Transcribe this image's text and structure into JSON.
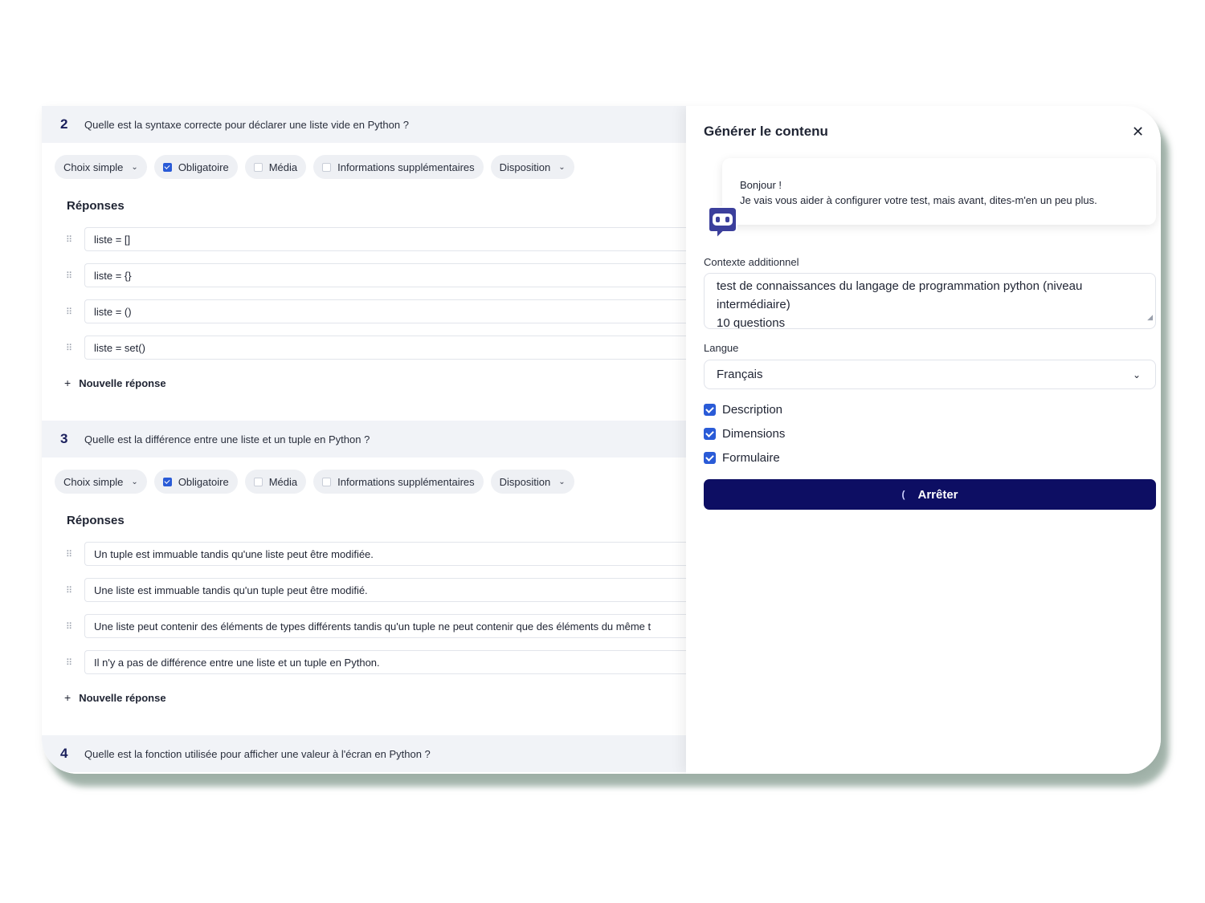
{
  "questions": [
    {
      "number": "2",
      "title": "Quelle est la syntaxe correcte pour déclarer une liste vide en Python ?",
      "type_label": "Choix simple",
      "required_label": "Obligatoire",
      "required_checked": true,
      "media_label": "Média",
      "media_checked": false,
      "extra_info_label": "Informations supplémentaires",
      "extra_info_checked": false,
      "layout_label": "Disposition",
      "answers_heading": "Réponses",
      "answers": [
        "liste = []",
        "liste = {}",
        "liste = ()",
        "liste = set()"
      ],
      "new_answer_label": "Nouvelle réponse"
    },
    {
      "number": "3",
      "title": "Quelle est la différence entre une liste et un tuple en Python ?",
      "type_label": "Choix simple",
      "required_label": "Obligatoire",
      "required_checked": true,
      "media_label": "Média",
      "media_checked": false,
      "extra_info_label": "Informations supplémentaires",
      "extra_info_checked": false,
      "layout_label": "Disposition",
      "answers_heading": "Réponses",
      "answers": [
        "Un tuple est immuable tandis qu'une liste peut être modifiée.",
        "Une liste est immuable tandis qu'un tuple peut être modifié.",
        "Une liste peut contenir des éléments de types différents tandis qu'un tuple ne peut contenir que des éléments du même t",
        "Il n'y a pas de différence entre une liste et un tuple en Python."
      ],
      "new_answer_label": "Nouvelle réponse"
    },
    {
      "number": "4",
      "title": "Quelle est la fonction utilisée pour afficher une valeur à l'écran en Python ?"
    }
  ],
  "panel": {
    "title": "Générer le contenu",
    "close_icon": "close-icon",
    "bot_message_line1": "Bonjour !",
    "bot_message_line2": "Je vais vous aider à configurer votre test, mais avant, dites-m'en un peu plus.",
    "context_label": "Contexte additionnel",
    "context_line1": "test de connaissances du langage de programmation python (niveau",
    "context_line2": "intermédiaire)",
    "context_line3": "10 questions",
    "language_label": "Langue",
    "language_value": "Français",
    "options": [
      {
        "label": "Description",
        "checked": true
      },
      {
        "label": "Dimensions",
        "checked": true
      },
      {
        "label": "Formulaire",
        "checked": true
      }
    ],
    "stop_label": "Arrêter"
  },
  "colors": {
    "accent_blue": "#2a5bd7",
    "stop_button": "#0d0e63",
    "question_header_bg": "#f1f3f7",
    "bot_icon": "#3b3f9c"
  }
}
